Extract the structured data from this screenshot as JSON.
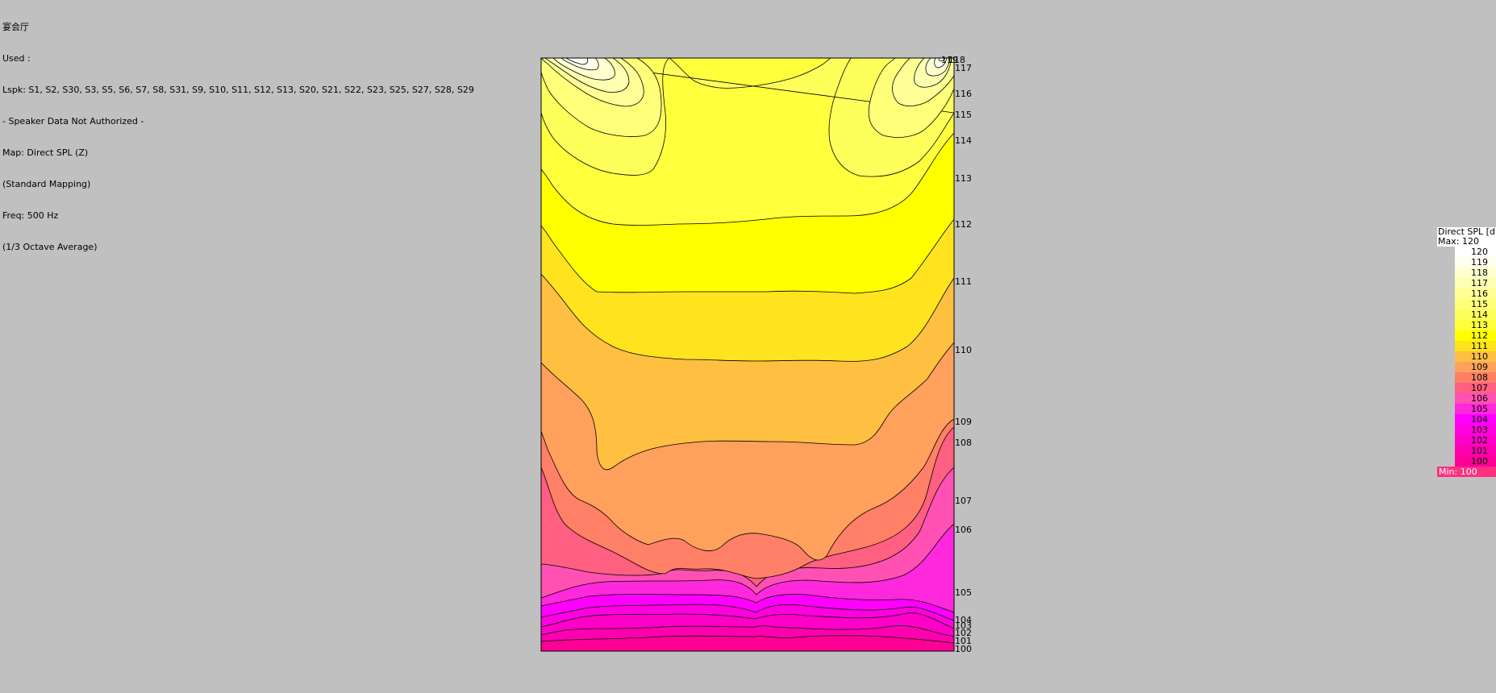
{
  "header": {
    "lines": [
      "宴会厅",
      "Used :",
      "Lspk: S1, S2, S30, S3, S5, S6, S7, S8, S31, S9, S10, S11, S12, S13, S20, S21, S22, S23, S25, S27, S28, S29",
      "- Speaker Data Not Authorized -",
      "Map: Direct SPL (Z)",
      "(Standard Mapping)",
      "Freq: 500 Hz",
      "(1/3 Octave Average)"
    ]
  },
  "legend": {
    "title": "Direct SPL [dB]",
    "max_label": "Max:  120",
    "min_label": "Min:  100",
    "entries": [
      {
        "value": "120",
        "color": "#ffffff"
      },
      {
        "value": "119",
        "color": "#ffffee"
      },
      {
        "value": "118",
        "color": "#ffffd0"
      },
      {
        "value": "117",
        "color": "#ffffb2"
      },
      {
        "value": "116",
        "color": "#ffff96"
      },
      {
        "value": "115",
        "color": "#ffff7a"
      },
      {
        "value": "114",
        "color": "#ffff5c"
      },
      {
        "value": "113",
        "color": "#ffff3c"
      },
      {
        "value": "112",
        "color": "#ffff00"
      },
      {
        "value": "111",
        "color": "#ffe31e"
      },
      {
        "value": "110",
        "color": "#ffbf40"
      },
      {
        "value": "109",
        "color": "#ffa05c"
      },
      {
        "value": "108",
        "color": "#ff8066"
      },
      {
        "value": "107",
        "color": "#ff5f80"
      },
      {
        "value": "106",
        "color": "#ff50b4"
      },
      {
        "value": "105",
        "color": "#ff28dc"
      },
      {
        "value": "104",
        "color": "#ff00ff"
      },
      {
        "value": "103",
        "color": "#ff00e0"
      },
      {
        "value": "102",
        "color": "#ff00c8"
      },
      {
        "value": "101",
        "color": "#ff00b0"
      },
      {
        "value": "100",
        "color": "#ff0096"
      }
    ],
    "min_color": "#ff3080"
  },
  "chart_data": {
    "type": "heatmap",
    "title": "",
    "units": "dB",
    "value_range": [
      100,
      120
    ],
    "contour_levels": [
      100,
      101,
      102,
      103,
      104,
      105,
      106,
      107,
      108,
      109,
      110,
      111,
      112,
      113,
      114,
      115,
      116,
      117,
      118,
      119
    ],
    "contour_labels": [
      "119",
      "118",
      "117",
      "116",
      "115",
      "114",
      "113",
      "112",
      "111",
      "110",
      "109",
      "108",
      "107",
      "106",
      "105",
      "104",
      "103",
      "102",
      "101",
      "100"
    ]
  }
}
